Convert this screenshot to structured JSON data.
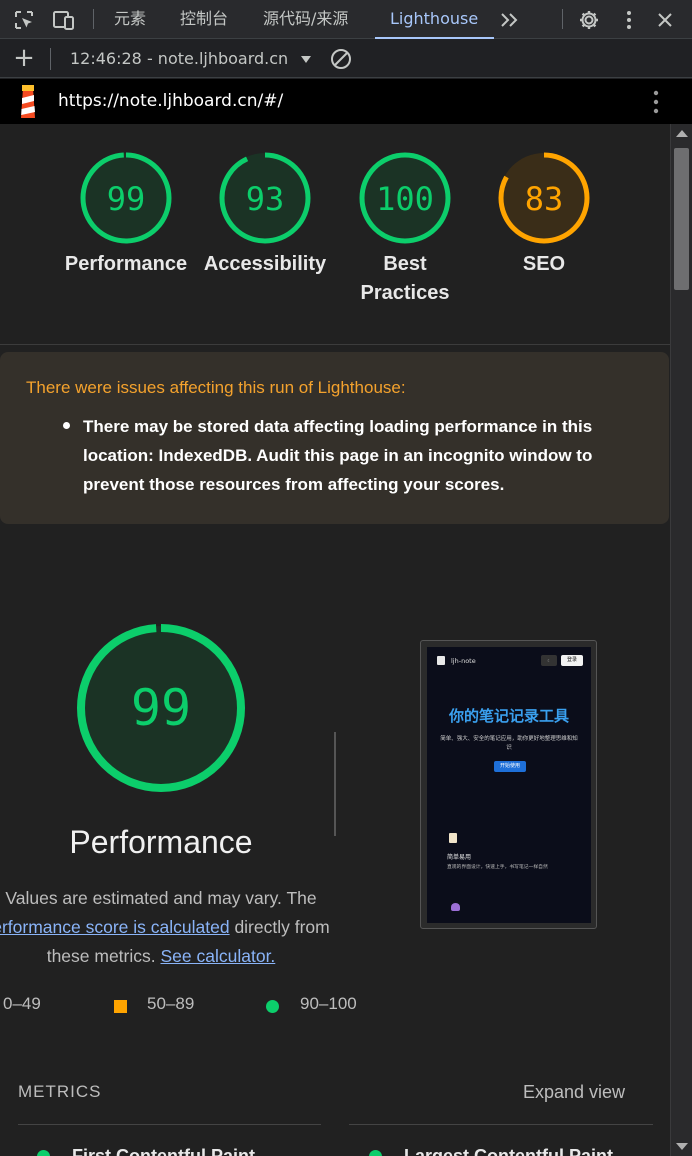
{
  "devtools": {
    "tabs": [
      "元素",
      "控制台",
      "源代码/来源",
      "Lighthouse"
    ],
    "active_tab": "Lighthouse",
    "more_tabs_icon": "chevron-double-right",
    "report_select": "12:46:28 - note.ljhboard.cn",
    "icons": [
      "inspect-element-icon",
      "device-toolbar-icon",
      "settings-gear-icon",
      "more-vert-icon",
      "close-icon",
      "plus-icon",
      "clear-icon",
      "dropdown-arrow-icon"
    ]
  },
  "urlbar": {
    "url": "https://note.ljhboard.cn/#/"
  },
  "scores": [
    {
      "label": "Performance",
      "score": "99",
      "value": 99,
      "color": "#0cce6b",
      "fill": "#1b3325"
    },
    {
      "label": "Accessibility",
      "score": "93",
      "value": 93,
      "color": "#0cce6b",
      "fill": "#1b3325"
    },
    {
      "label_lines": [
        "Best",
        "Practices"
      ],
      "score": "100",
      "value": 100,
      "color": "#0cce6b",
      "fill": "#1b3325"
    },
    {
      "label": "SEO",
      "score": "83",
      "value": 83,
      "color": "#ffa400",
      "fill": "#3a2d18"
    }
  ],
  "warning": {
    "title": "There were issues affecting this run of Lighthouse:",
    "items": [
      "There may be stored data affecting loading performance in this location: IndexedDB. Audit this page in an incognito window to prevent those resources from affecting your scores."
    ]
  },
  "performance": {
    "score": "99",
    "value": 99,
    "title": "Performance",
    "desc_line1": "Values are estimated and may vary. The",
    "desc_link1": "erformance score is calculated",
    "desc_line2_rest": " directly from",
    "desc_line3_pre": "these metrics. ",
    "desc_link2": "See calculator.",
    "color": "#0cce6b"
  },
  "screenshot": {
    "nav_title": "ljh-note",
    "nav_btn1": "☾",
    "nav_btn2": "登录",
    "hero": "你的笔记记录工具",
    "sub": "简单、强大、安全的笔记应用，助你更好地整理思维和知识",
    "cta": "开始使用",
    "feature_title": "简单易用",
    "feature_desc": "直观的界面设计，快速上手，书写笔记一样自然"
  },
  "legend": [
    {
      "range": "0–49",
      "shape": "triangle",
      "color": "#ff4e42"
    },
    {
      "range": "50–89",
      "shape": "square",
      "color": "#ffa400"
    },
    {
      "range": "90–100",
      "shape": "circle",
      "color": "#0cce6b"
    }
  ],
  "metrics": {
    "title": "METRICS",
    "expand": "Expand view",
    "items": [
      "First Contentful Paint",
      "Largest Contentful Paint"
    ]
  }
}
